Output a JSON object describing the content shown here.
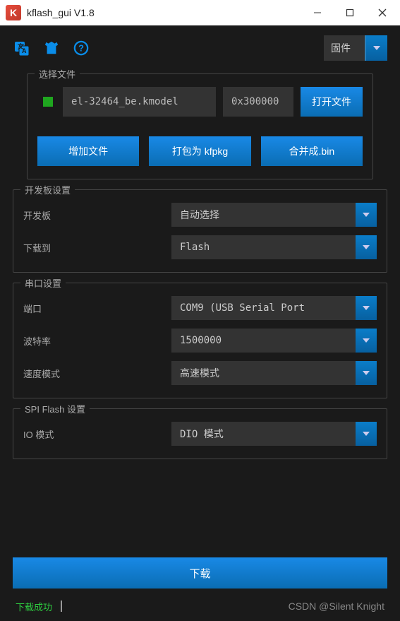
{
  "window": {
    "title": "kflash_gui V1.8"
  },
  "toolbar": {
    "mode_label": "固件"
  },
  "file_section": {
    "title": "选择文件",
    "file_value": "el-32464_be.kmodel",
    "addr_value": "0x300000",
    "open_button": "打开文件",
    "add_button": "增加文件",
    "pack_button": "打包为 kfpkg",
    "merge_button": "合并成.bin"
  },
  "board_section": {
    "title": "开发板设置",
    "rows": {
      "board_label": "开发板",
      "board_value": "自动选择",
      "target_label": "下载到",
      "target_value": "Flash"
    }
  },
  "serial_section": {
    "title": "串口设置",
    "rows": {
      "port_label": "端口",
      "port_value": "COM9 (USB Serial Port",
      "baud_label": "波特率",
      "baud_value": "1500000",
      "speed_label": "速度模式",
      "speed_value": "高速模式"
    }
  },
  "spi_section": {
    "title": "SPI Flash 设置",
    "rows": {
      "io_label": "IO 模式",
      "io_value": "DIO 模式"
    }
  },
  "download_button": "下载",
  "status": "下载成功",
  "watermark": "CSDN @Silent Knight"
}
